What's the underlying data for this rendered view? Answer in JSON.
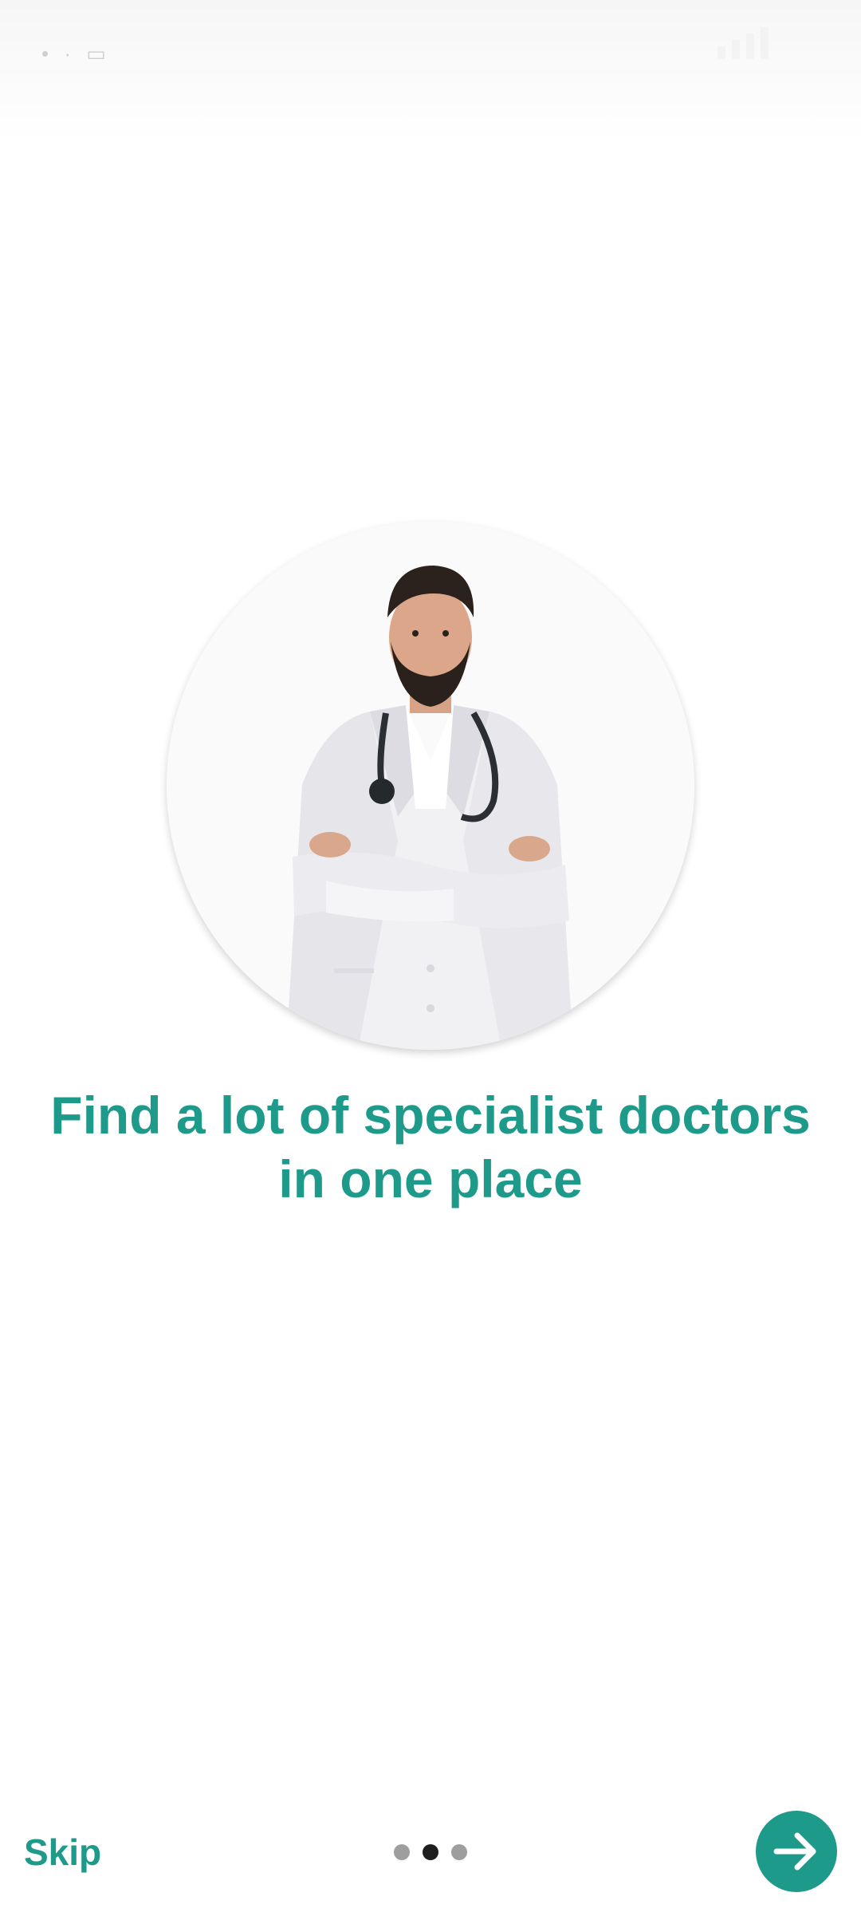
{
  "onboarding": {
    "headline_line1": "Find a lot of specialist doctors",
    "headline_line2": "in one place",
    "skip_label": "Skip",
    "page_indicator": {
      "total": 3,
      "current": 2
    },
    "accent_color": "#1e9a8b",
    "next_icon": "arrow-right-icon",
    "hero_image": "doctor-illustration"
  }
}
